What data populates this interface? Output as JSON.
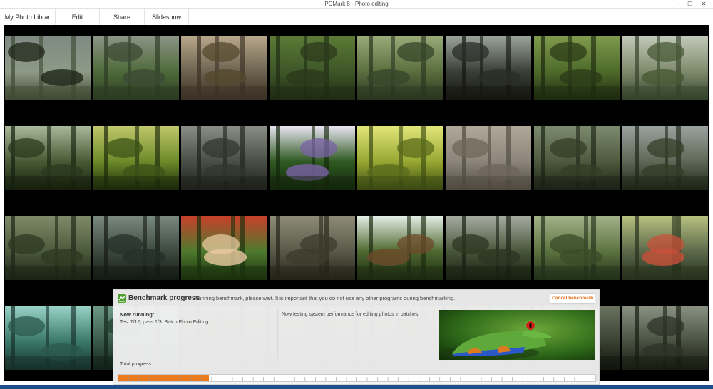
{
  "window": {
    "title": "PCMark 8 - Photo editing",
    "controls": {
      "minimize": "–",
      "restore": "❐",
      "close": "✕"
    }
  },
  "tabs": [
    {
      "label": "My Photo Librar"
    },
    {
      "label": "Edit"
    },
    {
      "label": "Share"
    },
    {
      "label": "Slideshow"
    }
  ],
  "gallery": {
    "rows": [
      [
        {
          "name": "photo-jungle-river",
          "palette": [
            "#8e9a86",
            "#3f4a34",
            "#7f8a84",
            "#1f2618"
          ]
        },
        {
          "name": "photo-creek-rocks",
          "palette": [
            "#4f6a3a",
            "#2a3a22",
            "#8c9486",
            "#3c4a34"
          ]
        },
        {
          "name": "photo-cave-arch",
          "palette": [
            "#6c6450",
            "#3a3024",
            "#b8a68a",
            "#54482e"
          ]
        },
        {
          "name": "photo-mossy-trees",
          "palette": [
            "#3e5628",
            "#1f2c14",
            "#5c7a36",
            "#2c3a1c"
          ]
        },
        {
          "name": "photo-forest-canopy",
          "palette": [
            "#5b6e3e",
            "#2a3620",
            "#98aa78",
            "#36462a"
          ]
        },
        {
          "name": "photo-flooded-forest",
          "palette": [
            "#3a3f36",
            "#15170f",
            "#9aa39a",
            "#2a2e28"
          ]
        },
        {
          "name": "photo-fern-tree",
          "palette": [
            "#4e6a2a",
            "#1c2a10",
            "#7e9a4c",
            "#2c3c18"
          ]
        },
        {
          "name": "photo-misty-hills",
          "palette": [
            "#7e8a6c",
            "#34422a",
            "#c2c8b8",
            "#485a36"
          ]
        }
      ],
      [
        {
          "name": "photo-tree-roots",
          "palette": [
            "#4a5a36",
            "#16200e",
            "#a8b89a",
            "#2c3a1e"
          ]
        },
        {
          "name": "photo-palm-forest",
          "palette": [
            "#6c8a2a",
            "#1c2a0c",
            "#c0c86a",
            "#3c5418"
          ]
        },
        {
          "name": "photo-dark-river",
          "palette": [
            "#4a4f46",
            "#1e221a",
            "#8a8e86",
            "#33382e"
          ]
        },
        {
          "name": "photo-passion-flower",
          "palette": [
            "#2f5a22",
            "#13260c",
            "#e8e4f0",
            "#7a62a6"
          ]
        },
        {
          "name": "photo-sunlit-jungle",
          "palette": [
            "#98a832",
            "#3a4a12",
            "#e2e67a",
            "#5c6c1c"
          ]
        },
        {
          "name": "photo-foggy-canopy",
          "palette": [
            "#8c857a",
            "#4f4a40",
            "#b0a898",
            "#6e675a"
          ]
        },
        {
          "name": "photo-swamp-trees",
          "palette": [
            "#4e5a3e",
            "#1c2216",
            "#7c8a6e",
            "#343e28"
          ]
        },
        {
          "name": "photo-overcast-jungle",
          "palette": [
            "#5e6856",
            "#1e2618",
            "#9aa2a0",
            "#34402a"
          ]
        }
      ],
      [
        {
          "name": "photo-palm-grove",
          "palette": [
            "#4c5a3c",
            "#1c2416",
            "#7e8c6a",
            "#2e3a22"
          ]
        },
        {
          "name": "photo-misty-branches",
          "palette": [
            "#3e4a3e",
            "#141a14",
            "#7a8a80",
            "#26302a"
          ]
        },
        {
          "name": "photo-red-flower",
          "palette": [
            "#4e7a2e",
            "#1a300e",
            "#c8402a",
            "#e8c8a0"
          ]
        },
        {
          "name": "photo-vine-forest",
          "palette": [
            "#5a5a4a",
            "#242418",
            "#8e8c78",
            "#3c3c2c"
          ]
        },
        {
          "name": "photo-waterfall",
          "palette": [
            "#4e6a30",
            "#1c2a10",
            "#e6eee6",
            "#6c4a2a"
          ]
        },
        {
          "name": "photo-rocky-stream",
          "palette": [
            "#48563a",
            "#182012",
            "#a6aca2",
            "#2c3622"
          ]
        },
        {
          "name": "photo-hanging-vines",
          "palette": [
            "#5c7440",
            "#22301a",
            "#a4b28a",
            "#3a4c28"
          ]
        },
        {
          "name": "photo-lily-pads",
          "palette": [
            "#5c6a4a",
            "#26301c",
            "#b8c080",
            "#c8503a"
          ]
        }
      ],
      [
        {
          "name": "photo-mangrove-lagoon",
          "palette": [
            "#3c7a6c",
            "#17302a",
            "#9ad4c8",
            "#2c5a4c"
          ]
        },
        {
          "name": "photo-lagoon-trees",
          "palette": [
            "#3a5a4a",
            "#12221a",
            "#6e9a88",
            "#24402e"
          ]
        },
        {
          "name": "photo-hidden-1",
          "palette": [
            "#2a2a24",
            "#101010",
            "#444438",
            "#1e1e18"
          ]
        },
        {
          "name": "photo-hidden-2",
          "palette": [
            "#2a2a24",
            "#101010",
            "#444438",
            "#1e1e18"
          ]
        },
        {
          "name": "photo-hidden-3",
          "palette": [
            "#2a2a24",
            "#101010",
            "#444438",
            "#1e1e18"
          ]
        },
        {
          "name": "photo-hidden-4",
          "palette": [
            "#2a2a24",
            "#101010",
            "#444438",
            "#1e1e18"
          ]
        },
        {
          "name": "photo-dark-grove",
          "palette": [
            "#3a4232",
            "#12160e",
            "#6a7460",
            "#262c20"
          ]
        },
        {
          "name": "photo-tall-trees",
          "palette": [
            "#4a5242",
            "#181c12",
            "#8a9284",
            "#2e3428"
          ]
        }
      ]
    ]
  },
  "benchmark": {
    "title": "Benchmark progress",
    "message": "Running benchmark, please wait. It is important that you do not use any other programs during benchmarking.",
    "cancel_label": "Cancel benchmark",
    "now_running_label": "Now running:",
    "test_text": "Test 7/12, pass 1/3: Batch Photo Editing",
    "description": "Now testing system performance for editing photos in batches.",
    "total_label": "Total progress:",
    "progress_percent": 19,
    "accent": "#ec7a1e",
    "icon": "benchmark-logo-icon"
  },
  "colors": {
    "gallery_bg": "#000000",
    "accent": "#ec7a1e",
    "taskbar": "#1e4e8c"
  }
}
